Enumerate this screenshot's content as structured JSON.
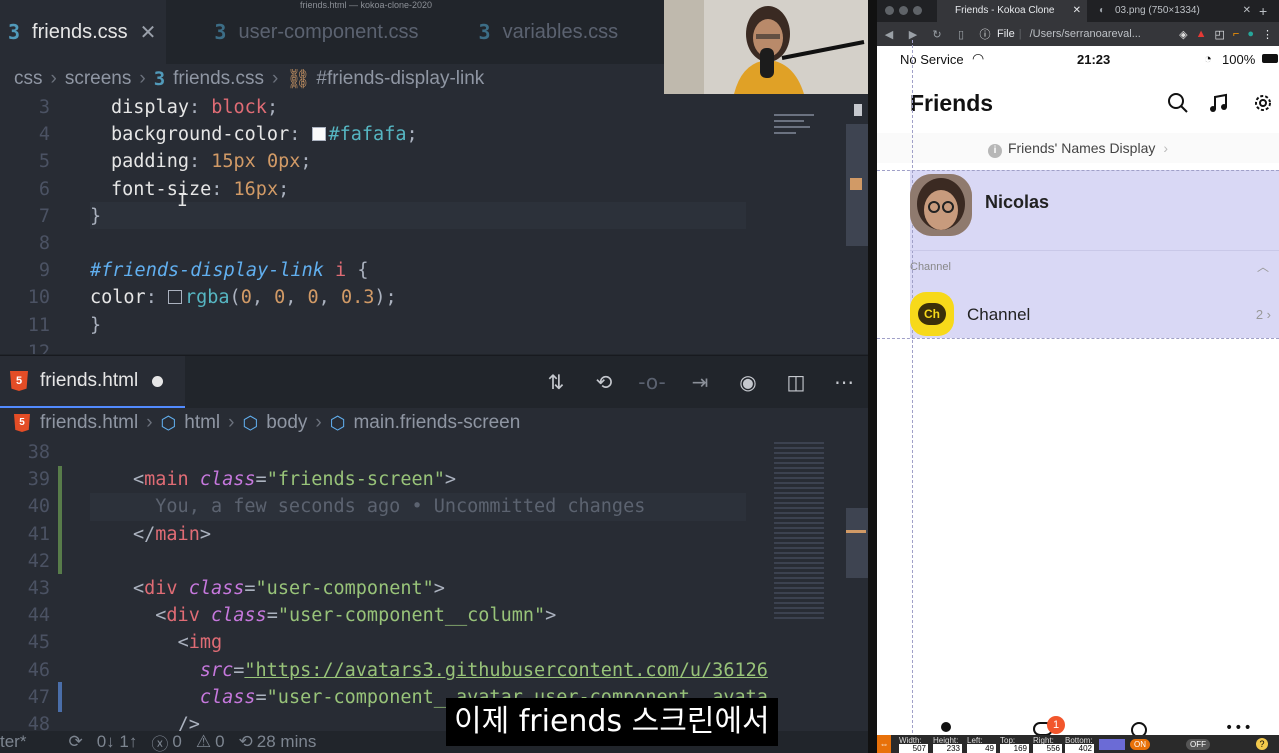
{
  "editor": {
    "window_title": "friends.html — kokoa-clone-2020",
    "tabs": [
      {
        "label": "friends.css",
        "icon": "css-file-icon",
        "active": true
      },
      {
        "label": "user-component.css",
        "icon": "css-file-icon",
        "active": false
      },
      {
        "label": "variables.css",
        "icon": "css-file-icon",
        "active": false
      }
    ],
    "breadcrumb1": [
      "css",
      "screens",
      "friends.css",
      "#friends-display-link"
    ],
    "css_lines": [
      {
        "n": "3",
        "html": "<span class='prop'>display</span>: <span class='kw'>block</span>;"
      },
      {
        "n": "4",
        "html": "<span class='prop'>background-color</span>: <span class='swatch' style='background:#fafafa'></span><span class='fn'>#fafafa</span>;"
      },
      {
        "n": "5",
        "html": "<span class='prop'>padding</span>: <span class='num'>15px</span> <span class='num'>0px</span>;"
      },
      {
        "n": "6",
        "html": "<span class='prop'>font-size</span>: <span class='num'>16px</span>;"
      },
      {
        "n": "7",
        "html": "<span class='punc'>}</span>"
      },
      {
        "n": "8",
        "html": ""
      },
      {
        "n": "9",
        "html": "<span class='sel'>#friends-display-link</span> <span class='kw'>i</span> <span class='punc'>{</span>"
      },
      {
        "n": "10",
        "html": "<span class='prop'>color</span>: <span class='swatch' style='background:transparent'></span><span class='fn'>rgba</span>(<span class='num'>0</span>, <span class='num'>0</span>, <span class='num'>0</span>, <span class='num'>0.3</span>);"
      },
      {
        "n": "11",
        "html": "<span class='punc'>}</span>"
      },
      {
        "n": "12",
        "html": ""
      }
    ],
    "tab2": {
      "label": "friends.html"
    },
    "breadcrumb2": [
      "friends.html",
      "html",
      "body",
      "main.friends-screen"
    ],
    "html_lines": [
      {
        "n": "38",
        "html": ""
      },
      {
        "n": "39",
        "html": "<span class='punc'>&lt;</span><span class='tag'>main</span> <span class='attr'>class</span><span class='punc'>=</span><span class='str'>\"friends-screen\"</span><span class='punc'>&gt;</span>"
      },
      {
        "n": "40",
        "html": "<span class='ghost'>  You, a few seconds ago • Uncommitted changes</span>"
      },
      {
        "n": "41",
        "html": "<span class='punc'>&lt;/</span><span class='tag'>main</span><span class='punc'>&gt;</span>"
      },
      {
        "n": "42",
        "html": ""
      },
      {
        "n": "43",
        "html": "<span class='punc'>&lt;</span><span class='tag'>div</span> <span class='attr'>class</span><span class='punc'>=</span><span class='str'>\"user-component\"</span><span class='punc'>&gt;</span>"
      },
      {
        "n": "44",
        "html": "  <span class='punc'>&lt;</span><span class='tag'>div</span> <span class='attr'>class</span><span class='punc'>=</span><span class='str'>\"user-component__column\"</span><span class='punc'>&gt;</span>"
      },
      {
        "n": "45",
        "html": "    <span class='punc'>&lt;</span><span class='tag'>img</span>"
      },
      {
        "n": "46",
        "html": "      <span class='attr'>src</span><span class='punc'>=</span><span class='str' style='text-decoration:underline'>\"https://avatars3.githubusercontent.com/u/36126</span>"
      },
      {
        "n": "47",
        "html": "      <span class='attr'>class</span><span class='punc'>=</span><span class='str'>\"user-component__avatar user-component__avata</span>"
      },
      {
        "n": "48",
        "html": "    <span class='punc'>/&gt;</span>"
      }
    ],
    "status": {
      "branch_suffix": "ter*",
      "sync": "0↓ 1↑",
      "errors": "0",
      "warnings": "0",
      "time": "28 mins"
    }
  },
  "caption": "이제 friends 스크린에서",
  "browser": {
    "tabs": [
      {
        "label": "Friends - Kokoa Clone",
        "active": true
      },
      {
        "label": "03.png (750×1334)",
        "active": false
      }
    ],
    "address": {
      "scheme": "File",
      "url": "/Users/serranoareval..."
    },
    "phone": {
      "carrier": "No Service",
      "time": "21:23",
      "battery": "100%",
      "title": "Friends",
      "names_link": "Friends' Names Display",
      "user_name": "Nicolas",
      "channel_section": "Channel",
      "channel_name": "Channel",
      "channel_count": "2",
      "tab_badge": "1"
    },
    "measure": {
      "labels": [
        "Width:",
        "Height:",
        "Left:",
        "Top:",
        "Right:",
        "Bottom:"
      ],
      "values": [
        "507",
        "233",
        "49",
        "169",
        "556",
        "402"
      ],
      "on": "ON",
      "off": "OFF"
    }
  },
  "colors": {
    "accent_blue": "#528bff",
    "css_icon": "#519aba",
    "html_icon": "#e44d26",
    "highlight": "#d9d8f5",
    "kakao_yellow": "#f7d91a"
  }
}
